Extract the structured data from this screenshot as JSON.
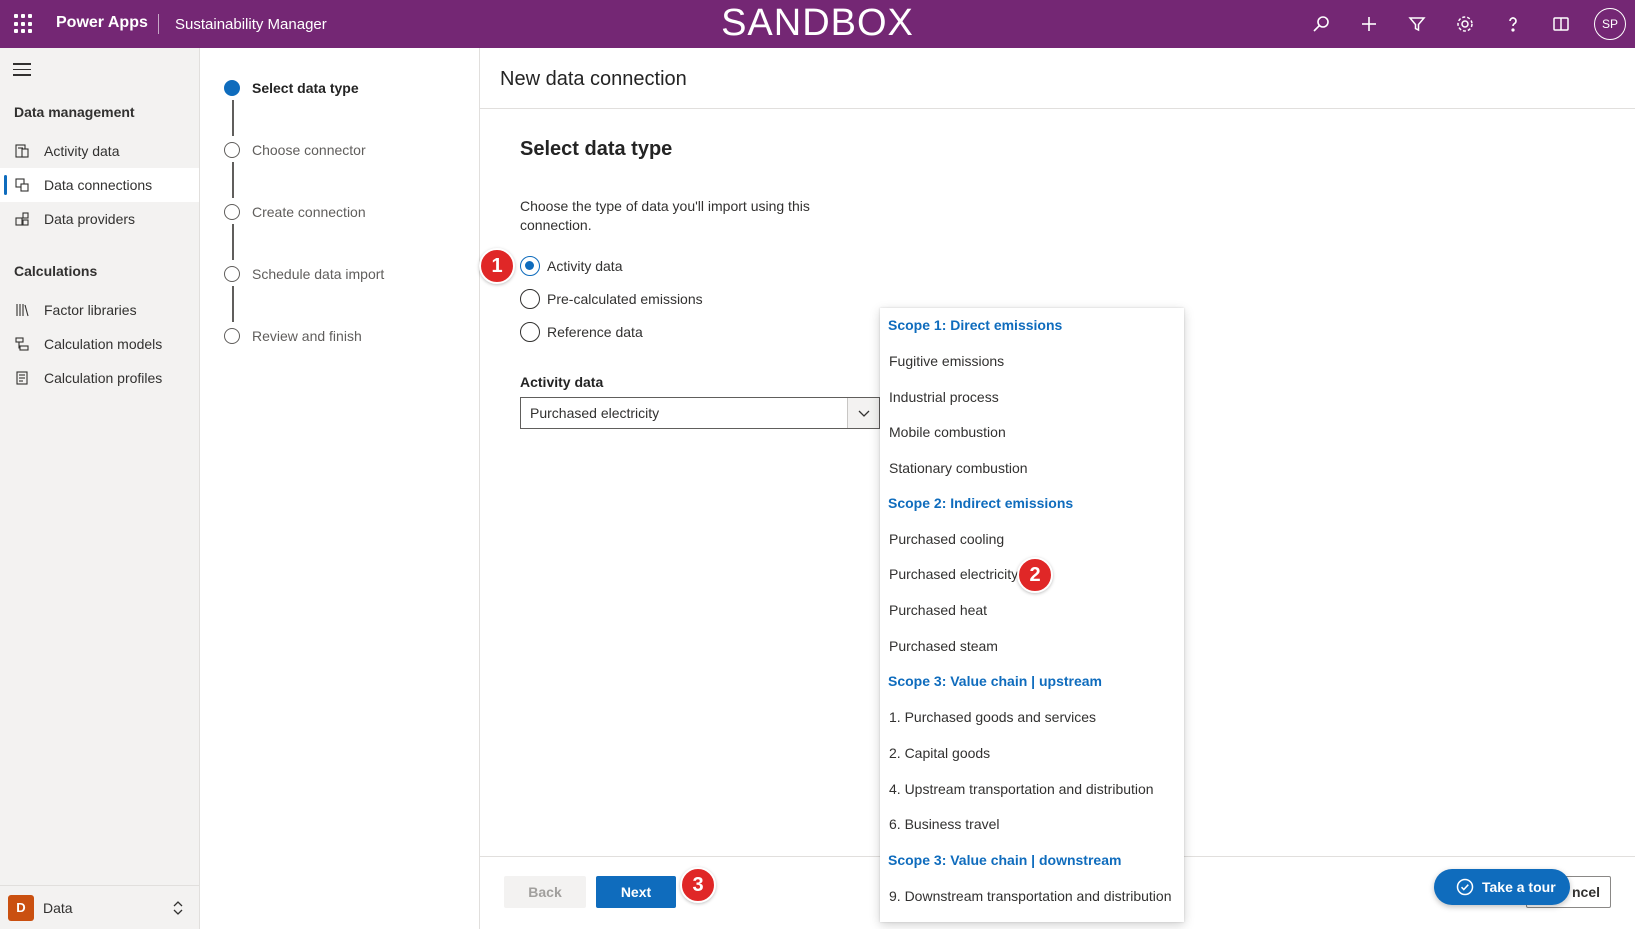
{
  "topbar": {
    "app_name": "Power Apps",
    "environment": "Sustainability Manager",
    "banner": "SANDBOX",
    "avatar_initials": "SP",
    "icons": [
      "search-icon",
      "add-icon",
      "filter-icon",
      "settings-icon",
      "help-icon",
      "book-icon"
    ],
    "color": "#742774"
  },
  "leftnav": {
    "groups": [
      {
        "title": "Data management",
        "items": [
          {
            "label": "Activity data",
            "icon": "activity-data-icon"
          },
          {
            "label": "Data connections",
            "icon": "data-connections-icon",
            "active": true
          },
          {
            "label": "Data providers",
            "icon": "data-providers-icon"
          }
        ]
      },
      {
        "title": "Calculations",
        "items": [
          {
            "label": "Factor libraries",
            "icon": "library-icon"
          },
          {
            "label": "Calculation models",
            "icon": "model-icon"
          },
          {
            "label": "Calculation profiles",
            "icon": "profile-icon"
          }
        ]
      }
    ],
    "area": {
      "badge": "D",
      "label": "Data"
    }
  },
  "stepper": {
    "steps": [
      {
        "label": "Select data type",
        "current": true
      },
      {
        "label": "Choose connector"
      },
      {
        "label": "Create connection"
      },
      {
        "label": "Schedule data import"
      },
      {
        "label": "Review and finish"
      }
    ]
  },
  "main": {
    "page_title": "New data connection",
    "section_title": "Select data type",
    "description": "Choose the type of data you'll import using this connection.",
    "radios": [
      {
        "label": "Activity data",
        "checked": true
      },
      {
        "label": "Pre-calculated emissions",
        "checked": false
      },
      {
        "label": "Reference data",
        "checked": false
      }
    ],
    "field_label": "Activity data",
    "combo_value": "Purchased electricity",
    "buttons": {
      "back": "Back",
      "next": "Next",
      "cancel": "ncel"
    }
  },
  "dropdown": {
    "options": [
      {
        "label": "Scope 1: Direct emissions",
        "header": true
      },
      {
        "label": "Fugitive emissions"
      },
      {
        "label": "Industrial process"
      },
      {
        "label": "Mobile combustion"
      },
      {
        "label": "Stationary combustion"
      },
      {
        "label": "Scope 2: Indirect emissions",
        "header": true
      },
      {
        "label": "Purchased cooling"
      },
      {
        "label": "Purchased electricity"
      },
      {
        "label": "Purchased heat"
      },
      {
        "label": "Purchased steam"
      },
      {
        "label": "Scope 3: Value chain | upstream",
        "header": true
      },
      {
        "label": "1. Purchased goods and services"
      },
      {
        "label": "2. Capital goods"
      },
      {
        "label": "4. Upstream transportation and distribution"
      },
      {
        "label": "6. Business travel"
      },
      {
        "label": "Scope 3: Value chain | downstream",
        "header": true
      },
      {
        "label": "9. Downstream transportation and distribution"
      }
    ]
  },
  "annotations": {
    "one": "1",
    "two": "2",
    "three": "3",
    "color": "#e02727"
  },
  "tour": {
    "label": "Take a tour"
  }
}
